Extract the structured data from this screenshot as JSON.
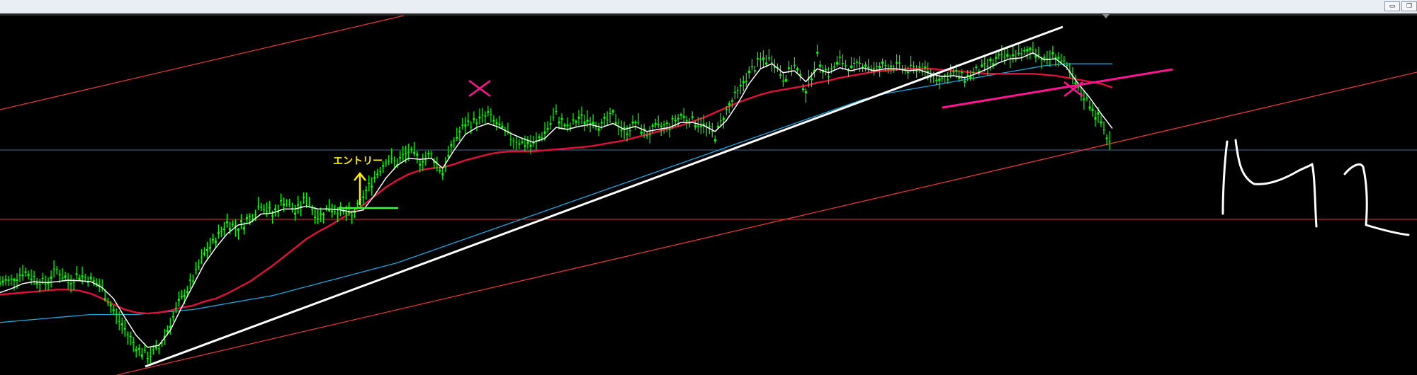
{
  "window": {
    "minimize_label": "▭",
    "restore_label": "❐"
  },
  "chart_data": {
    "type": "line",
    "timeframe": "M1",
    "annotation_entry": "エントリー",
    "handwritten_label": "M1",
    "grid": false,
    "background": "#000000",
    "colors": {
      "candles": "#00ff00",
      "ma_short": "#ffffff",
      "ma_mid": "#e0103a",
      "ma_long": "#1aa6e0",
      "channel": "#e23838",
      "trendline": "#ffffff",
      "marker": "#ff1493",
      "entry_line": "#33ff33",
      "entry_text": "#ffee00",
      "hline_blue": "#4a6b9a",
      "hline_red": "#e23838",
      "handwriting": "#ffffff"
    },
    "series": [
      {
        "name": "",
        "kind": "price",
        "values": [
          40,
          45,
          62,
          50,
          38,
          66,
          42,
          56,
          47,
          28,
          -18,
          -55,
          -90,
          -108,
          -92,
          -40,
          8,
          46,
          98,
          128,
          162,
          150,
          170,
          200,
          176,
          206,
          182,
          210,
          172,
          192,
          184,
          172,
          213,
          253,
          288,
          282,
          303,
          286,
          296,
          262,
          326,
          358,
          366,
          378,
          352,
          332,
          322,
          316,
          344,
          378,
          348,
          370,
          368,
          356,
          376,
          342,
          362,
          338,
          352,
          356,
          376,
          366,
          356,
          336,
          386,
          422,
          462,
          486,
          490,
          452,
          476,
          426,
          492,
          460,
          486,
          470,
          482,
          468,
          476,
          476,
          466,
          474,
          458,
          450,
          460,
          452,
          464,
          476,
          490,
          496,
          496,
          512,
          486,
          500,
          470,
          426,
          400,
          360,
          310
        ]
      },
      {
        "name": "",
        "kind": "ma_short",
        "values": [
          20,
          28,
          38,
          42,
          40,
          42,
          45,
          44,
          42,
          30,
          8,
          -30,
          -66,
          -90,
          -86,
          -56,
          -10,
          34,
          78,
          110,
          138,
          156,
          160,
          178,
          180,
          188,
          188,
          194,
          188,
          188,
          186,
          182,
          186,
          216,
          250,
          276,
          290,
          288,
          290,
          270,
          306,
          338,
          352,
          360,
          352,
          340,
          330,
          322,
          330,
          352,
          348,
          354,
          358,
          352,
          360,
          348,
          354,
          344,
          348,
          352,
          362,
          362,
          356,
          344,
          366,
          400,
          440,
          470,
          480,
          462,
          466,
          444,
          470,
          462,
          472,
          466,
          472,
          466,
          470,
          470,
          466,
          468,
          460,
          454,
          456,
          452,
          460,
          470,
          482,
          490,
          492,
          502,
          488,
          490,
          472,
          440,
          412,
          380,
          350
        ]
      },
      {
        "name": "",
        "kind": "ma_mid",
        "values": [
          16,
          18,
          20,
          22,
          24,
          26,
          26,
          24,
          18,
          8,
          -4,
          -14,
          -20,
          -22,
          -20,
          -16,
          -10,
          -6,
          2,
          8,
          18,
          30,
          42,
          58,
          74,
          92,
          110,
          128,
          142,
          154,
          168,
          182,
          196,
          214,
          232,
          246,
          258,
          266,
          270,
          272,
          278,
          286,
          292,
          298,
          302,
          304,
          304,
          304,
          306,
          308,
          310,
          312,
          314,
          318,
          322,
          326,
          332,
          338,
          344,
          350,
          356,
          364,
          372,
          382,
          392,
          402,
          410,
          418,
          424,
          428,
          432,
          436,
          442,
          446,
          452,
          456,
          460,
          464,
          466,
          468,
          470,
          470,
          470,
          468,
          466,
          464,
          462,
          460,
          460,
          460,
          460,
          460,
          458,
          456,
          452,
          448,
          444,
          440,
          432
        ]
      },
      {
        "name": "",
        "kind": "ma_long",
        "values": [
          -40,
          -38,
          -36,
          -34,
          -32,
          -30,
          -28,
          -26,
          -24,
          -24,
          -24,
          -24,
          -24,
          -22,
          -20,
          -18,
          -16,
          -14,
          -10,
          -6,
          -2,
          2,
          6,
          10,
          14,
          20,
          26,
          32,
          38,
          44,
          50,
          56,
          62,
          68,
          74,
          80,
          88,
          96,
          104,
          112,
          120,
          128,
          136,
          144,
          152,
          160,
          168,
          176,
          184,
          192,
          200,
          208,
          216,
          224,
          232,
          240,
          248,
          256,
          264,
          272,
          280,
          288,
          296,
          304,
          312,
          320,
          328,
          336,
          344,
          352,
          360,
          368,
          376,
          384,
          392,
          400,
          408,
          414,
          420,
          424,
          428,
          432,
          436,
          440,
          444,
          448,
          452,
          456,
          460,
          464,
          468,
          472,
          476,
          478,
          480,
          480,
          480,
          480,
          480
        ]
      }
    ]
  }
}
